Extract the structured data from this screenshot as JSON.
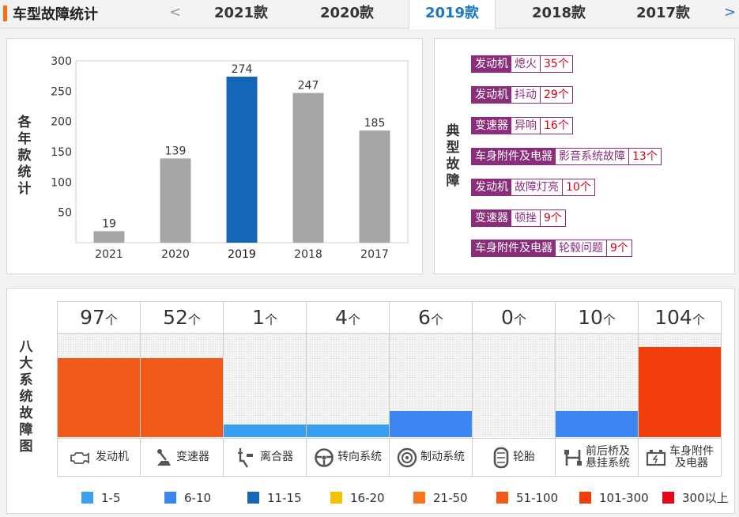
{
  "header": {
    "title": "车型故障统计",
    "prev_arrow": "<",
    "next_arrow": ">",
    "tabs": [
      {
        "label": "2021款",
        "active": false
      },
      {
        "label": "2020款",
        "active": false
      },
      {
        "label": "2019款",
        "active": true
      },
      {
        "label": "2018款",
        "active": false
      },
      {
        "label": "2017款",
        "active": false
      }
    ]
  },
  "chart_panel": {
    "side_label": "各年款统计"
  },
  "chart_data": {
    "type": "bar",
    "categories": [
      "2021",
      "2020",
      "2019",
      "2018",
      "2017"
    ],
    "values": [
      19,
      139,
      274,
      247,
      185
    ],
    "highlight_index": 2,
    "ylim": [
      0,
      300
    ],
    "yticks": [
      50,
      100,
      150,
      200,
      250,
      300
    ],
    "colors": {
      "normal": "#a6a6a6",
      "highlight": "#1565b8"
    },
    "title": "",
    "xlabel": "",
    "ylabel": ""
  },
  "faults_panel": {
    "side_label": "典型故障",
    "items": [
      {
        "category": "发动机",
        "fault": "熄火",
        "count": "35个"
      },
      {
        "category": "发动机",
        "fault": "抖动",
        "count": "29个"
      },
      {
        "category": "变速器",
        "fault": "异响",
        "count": "16个"
      },
      {
        "category": "车身附件及电器",
        "fault": "影音系统故障",
        "count": "13个"
      },
      {
        "category": "发动机",
        "fault": "故障灯亮",
        "count": "10个"
      },
      {
        "category": "变速器",
        "fault": "顿挫",
        "count": "9个"
      },
      {
        "category": "车身附件及电器",
        "fault": "轮毂问题",
        "count": "9个"
      }
    ]
  },
  "systems_panel": {
    "side_label": "八大系统故障图",
    "unit": "个",
    "systems": [
      {
        "name": "发动机",
        "count": "97",
        "icon": "engine-icon",
        "level": 0.76,
        "color": "#f25a1c"
      },
      {
        "name": "变速器",
        "count": "52",
        "icon": "gear-shift-icon",
        "level": 0.76,
        "color": "#f25a1c"
      },
      {
        "name": "离合器",
        "count": "1",
        "icon": "clutch-icon",
        "level": 0.12,
        "color": "#3a9ff0"
      },
      {
        "name": "转向系统",
        "count": "4",
        "icon": "steering-wheel-icon",
        "level": 0.12,
        "color": "#3a9ff0"
      },
      {
        "name": "制动系统",
        "count": "6",
        "icon": "brake-disc-icon",
        "level": 0.25,
        "color": "#3b86f0"
      },
      {
        "name": "轮胎",
        "count": "0",
        "icon": "tire-icon",
        "level": 0,
        "color": "#3a9ff0"
      },
      {
        "name": "前后桥及悬挂系统",
        "name_lines": [
          "前后桥及",
          "悬挂系统"
        ],
        "count": "10",
        "icon": "suspension-icon",
        "level": 0.25,
        "color": "#3b86f0"
      },
      {
        "name": "车身附件及电器",
        "name_lines": [
          "车身附件",
          "及电器"
        ],
        "count": "104",
        "icon": "battery-icon",
        "level": 0.87,
        "color": "#f23d0c"
      }
    ]
  },
  "legend": [
    {
      "label": "1-5",
      "color": "#3aa0f0"
    },
    {
      "label": "6-10",
      "color": "#3a86f0"
    },
    {
      "label": "11-15",
      "color": "#1565b8"
    },
    {
      "label": "16-20",
      "color": "#f5c200"
    },
    {
      "label": "21-50",
      "color": "#f5761c"
    },
    {
      "label": "51-100",
      "color": "#f25a1c"
    },
    {
      "label": "101-300",
      "color": "#f23d0c"
    },
    {
      "label": "300以上",
      "color": "#e8071a"
    }
  ]
}
